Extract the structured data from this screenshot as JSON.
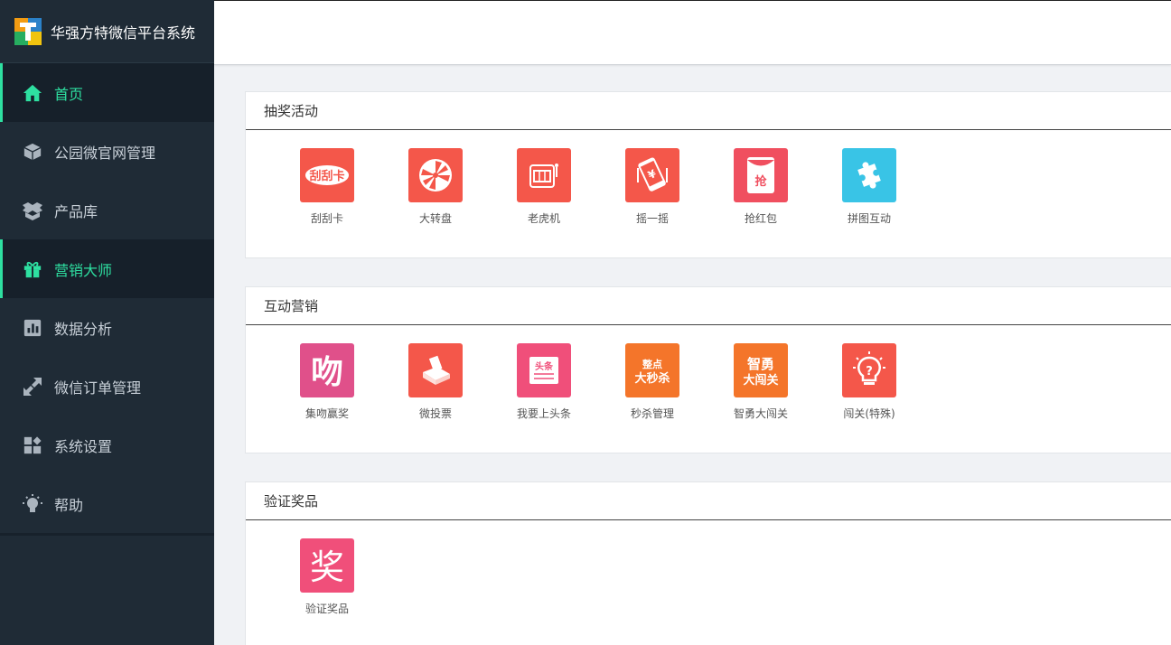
{
  "brand": {
    "title": "华强方特微信平台系统"
  },
  "sidebar": {
    "items": [
      {
        "label": "首页",
        "icon": "home-icon",
        "active": true
      },
      {
        "label": "公园微官网管理",
        "icon": "cube-icon",
        "active": false
      },
      {
        "label": "产品库",
        "icon": "boxes-icon",
        "active": false
      },
      {
        "label": "营销大师",
        "icon": "gift-icon",
        "active": true
      },
      {
        "label": "数据分析",
        "icon": "bar-chart-icon",
        "active": false
      },
      {
        "label": "微信订单管理",
        "icon": "arrows-icon",
        "active": false
      },
      {
        "label": "系统设置",
        "icon": "widgets-icon",
        "active": false
      },
      {
        "label": "帮助",
        "icon": "lightbulb-icon",
        "active": false
      }
    ]
  },
  "panels": [
    {
      "title": "抽奖活动",
      "apps": [
        {
          "label": "刮刮卡",
          "icon": "scratch-card-icon",
          "color": "#f4574a"
        },
        {
          "label": "大转盘",
          "icon": "wheel-icon",
          "color": "#f4574a"
        },
        {
          "label": "老虎机",
          "icon": "slot-machine-icon",
          "color": "#f4574a"
        },
        {
          "label": "摇一摇",
          "icon": "shake-phone-icon",
          "color": "#f4574a"
        },
        {
          "label": "抢红包",
          "icon": "red-packet-icon",
          "color": "#f04f5f"
        },
        {
          "label": "拼图互动",
          "icon": "puzzle-icon",
          "color": "#39c4e6"
        }
      ]
    },
    {
      "title": "互动营销",
      "apps": [
        {
          "label": "集吻赢奖",
          "icon": "kiss-icon",
          "color": "#e0508a"
        },
        {
          "label": "微投票",
          "icon": "ballot-box-icon",
          "color": "#f4574a"
        },
        {
          "label": "我要上头条",
          "icon": "headline-icon",
          "color": "#f04f7a"
        },
        {
          "label": "秒杀管理",
          "icon": "flash-sale-icon",
          "color": "#f4752a"
        },
        {
          "label": "智勇大闯关",
          "icon": "challenge-icon",
          "color": "#f4752a"
        },
        {
          "label": "闯关(特殊)",
          "icon": "lightbulb-question-icon",
          "color": "#f4574a"
        }
      ]
    },
    {
      "title": "验证奖品",
      "apps": [
        {
          "label": "验证奖品",
          "icon": "prize-icon",
          "color": "#f04f7a"
        }
      ]
    }
  ]
}
